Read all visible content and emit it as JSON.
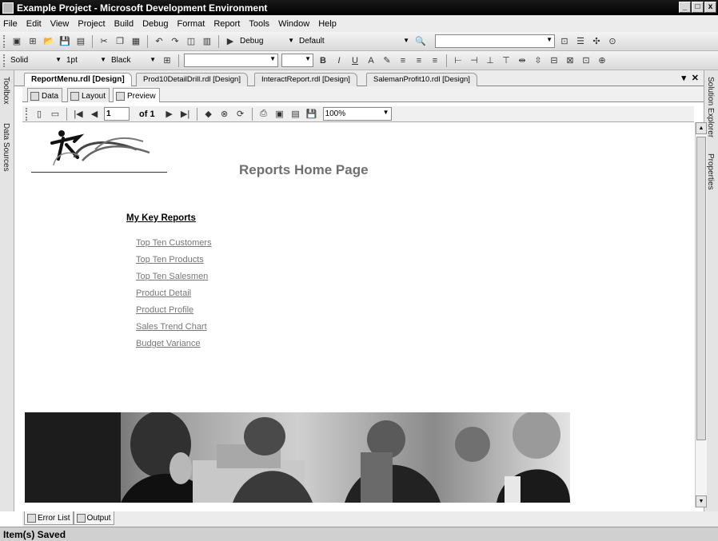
{
  "window": {
    "title": "Example Project - Microsoft Development Environment",
    "controls": [
      "_",
      "□",
      "x"
    ]
  },
  "menu": [
    "File",
    "Edit",
    "View",
    "Project",
    "Build",
    "Debug",
    "Format",
    "Report",
    "Tools",
    "Window",
    "Help"
  ],
  "standard_toolbar": {
    "config": "Debug",
    "platform": "Default"
  },
  "format_toolbar": {
    "border_style": "Solid",
    "border_width": "1pt",
    "color": "Black"
  },
  "side_panels": {
    "left": [
      "Toolbox",
      "Data Sources"
    ],
    "right": [
      "Solution Explorer",
      "Properties"
    ]
  },
  "doc_tabs": [
    {
      "label": "ReportMenu.rdl [Design]",
      "active": true
    },
    {
      "label": "Prod10DetailDrill.rdl [Design]",
      "active": false
    },
    {
      "label": "InteractReport.rdl [Design]",
      "active": false
    },
    {
      "label": "SalemanProfit10.rdl [Design]",
      "active": false
    }
  ],
  "doc_tab_controls": {
    "dropdown": "▾",
    "close": "✕"
  },
  "view_tabs": [
    {
      "label": "Data",
      "active": false
    },
    {
      "label": "Layout",
      "active": false
    },
    {
      "label": "Preview",
      "active": true
    }
  ],
  "preview_toolbar": {
    "page_number": "1",
    "page_total": "of 1",
    "zoom": "100%"
  },
  "report": {
    "title": "Reports Home Page",
    "key_reports_heading": "My Key Reports",
    "links": [
      "Top Ten Customers",
      "Top Ten Products",
      "Top Ten Salesmen",
      "Product Detail",
      "Product Profile",
      "Sales Trend Chart",
      "Budget Variance"
    ]
  },
  "bottom_tabs": [
    "Error List",
    "Output"
  ],
  "status": "Item(s) Saved"
}
